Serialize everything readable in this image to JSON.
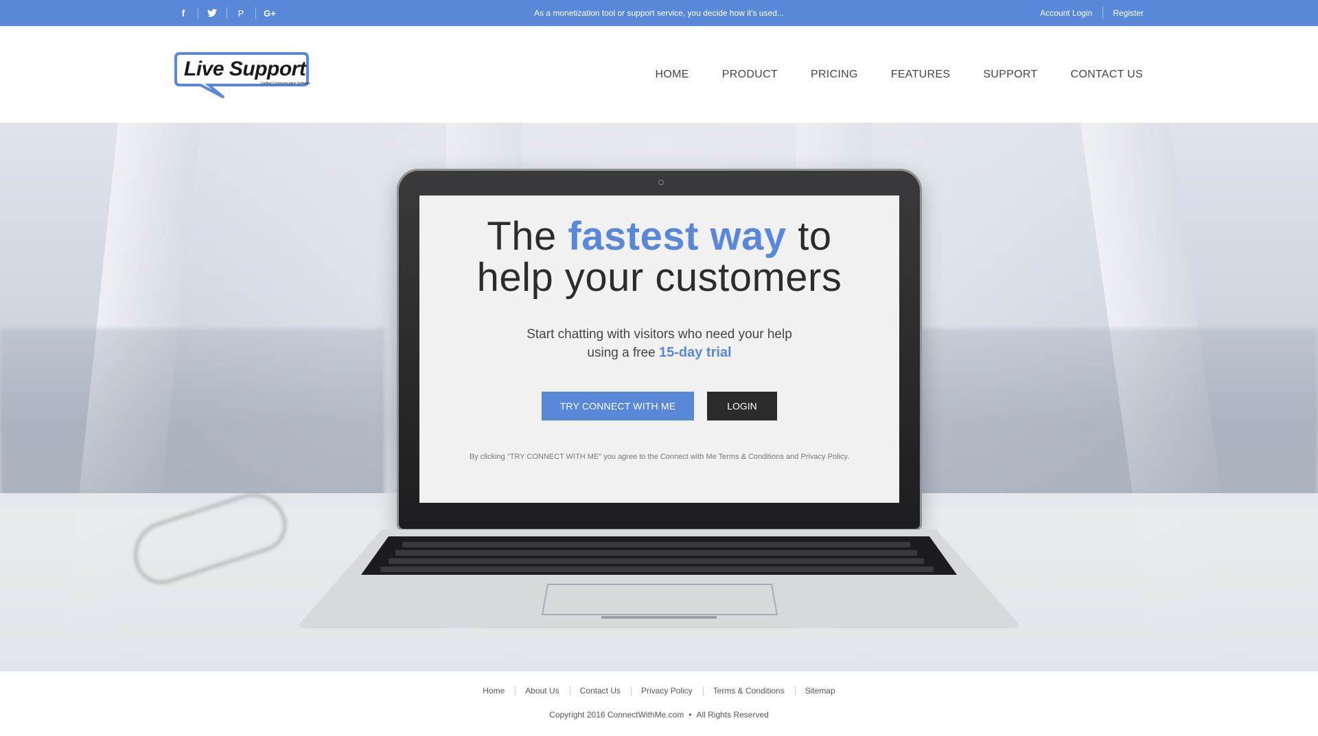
{
  "topbar": {
    "social": [
      {
        "icon": "facebook-icon",
        "glyph": "f"
      },
      {
        "icon": "twitter-icon",
        "glyph": "t"
      },
      {
        "icon": "pinterest-icon",
        "glyph": "P"
      },
      {
        "icon": "google-plus-icon",
        "glyph": "G+"
      }
    ],
    "tagline": "As a monetization tool or support service, you decide how it's used...",
    "account_login": "Account Login",
    "register": "Register",
    "color": "#5a88d8"
  },
  "header": {
    "logo_text": "Live Support",
    "logo_subtext": "Unified Communication Software",
    "nav": [
      "HOME",
      "PRODUCT",
      "PRICING",
      "FEATURES",
      "SUPPORT",
      "CONTACT US"
    ]
  },
  "hero": {
    "headline_pre": "The ",
    "headline_highlight": "fastest way",
    "headline_post": " to",
    "headline_line2": "help your customers",
    "sub_line1": "Start chatting with visitors who need your help",
    "sub_line2_pre": "using a free ",
    "sub_line2_highlight": "15-day trial",
    "try_button": "TRY CONNECT WITH ME",
    "login_button": "LOGIN",
    "disclaimer": "By clicking \"TRY CONNECT WITH ME\" you agree to the Connect with Me Terms & Conditions and Privacy Policy."
  },
  "footer": {
    "links": [
      "Home",
      "About Us",
      "Contact Us",
      "Privacy Policy",
      "Terms & Conditions",
      "Sitemap"
    ],
    "copyright": "Copyright 2016 ConnectWithMe.com",
    "dot": "•",
    "rights": "All Rights Reserved"
  }
}
